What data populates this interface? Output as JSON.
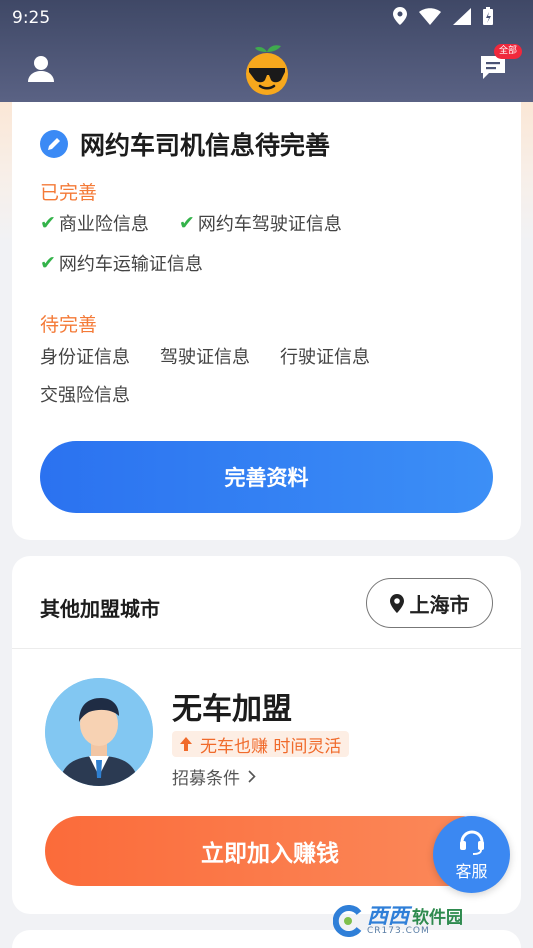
{
  "status_bar": {
    "time": "9:25"
  },
  "header": {
    "message_badge": "全部"
  },
  "profile_card": {
    "title": "网约车司机信息待完善",
    "done_label": "已完善",
    "done_items": [
      "商业险信息",
      "网约车驾驶证信息",
      "网约车运输证信息"
    ],
    "todo_label": "待完善",
    "todo_items": [
      "身份证信息",
      "驾驶证信息",
      "行驶证信息",
      "交强险信息"
    ],
    "complete_button": "完善资料"
  },
  "join_card": {
    "cities_title": "其他加盟城市",
    "city": "上海市",
    "join_title": "无车加盟",
    "tag": "无车也赚 时间灵活",
    "requirements_link": "招募条件",
    "join_button": "立即加入赚钱"
  },
  "service_button": "客服",
  "watermark": {
    "brand": "西西",
    "brand2": "软件园",
    "sub": "CR173.COM"
  },
  "colors": {
    "primary_blue": "#2b72f0",
    "accent_orange": "#fb6b3a",
    "header_bg": "#3f4866",
    "check_green": "#34b34a"
  }
}
